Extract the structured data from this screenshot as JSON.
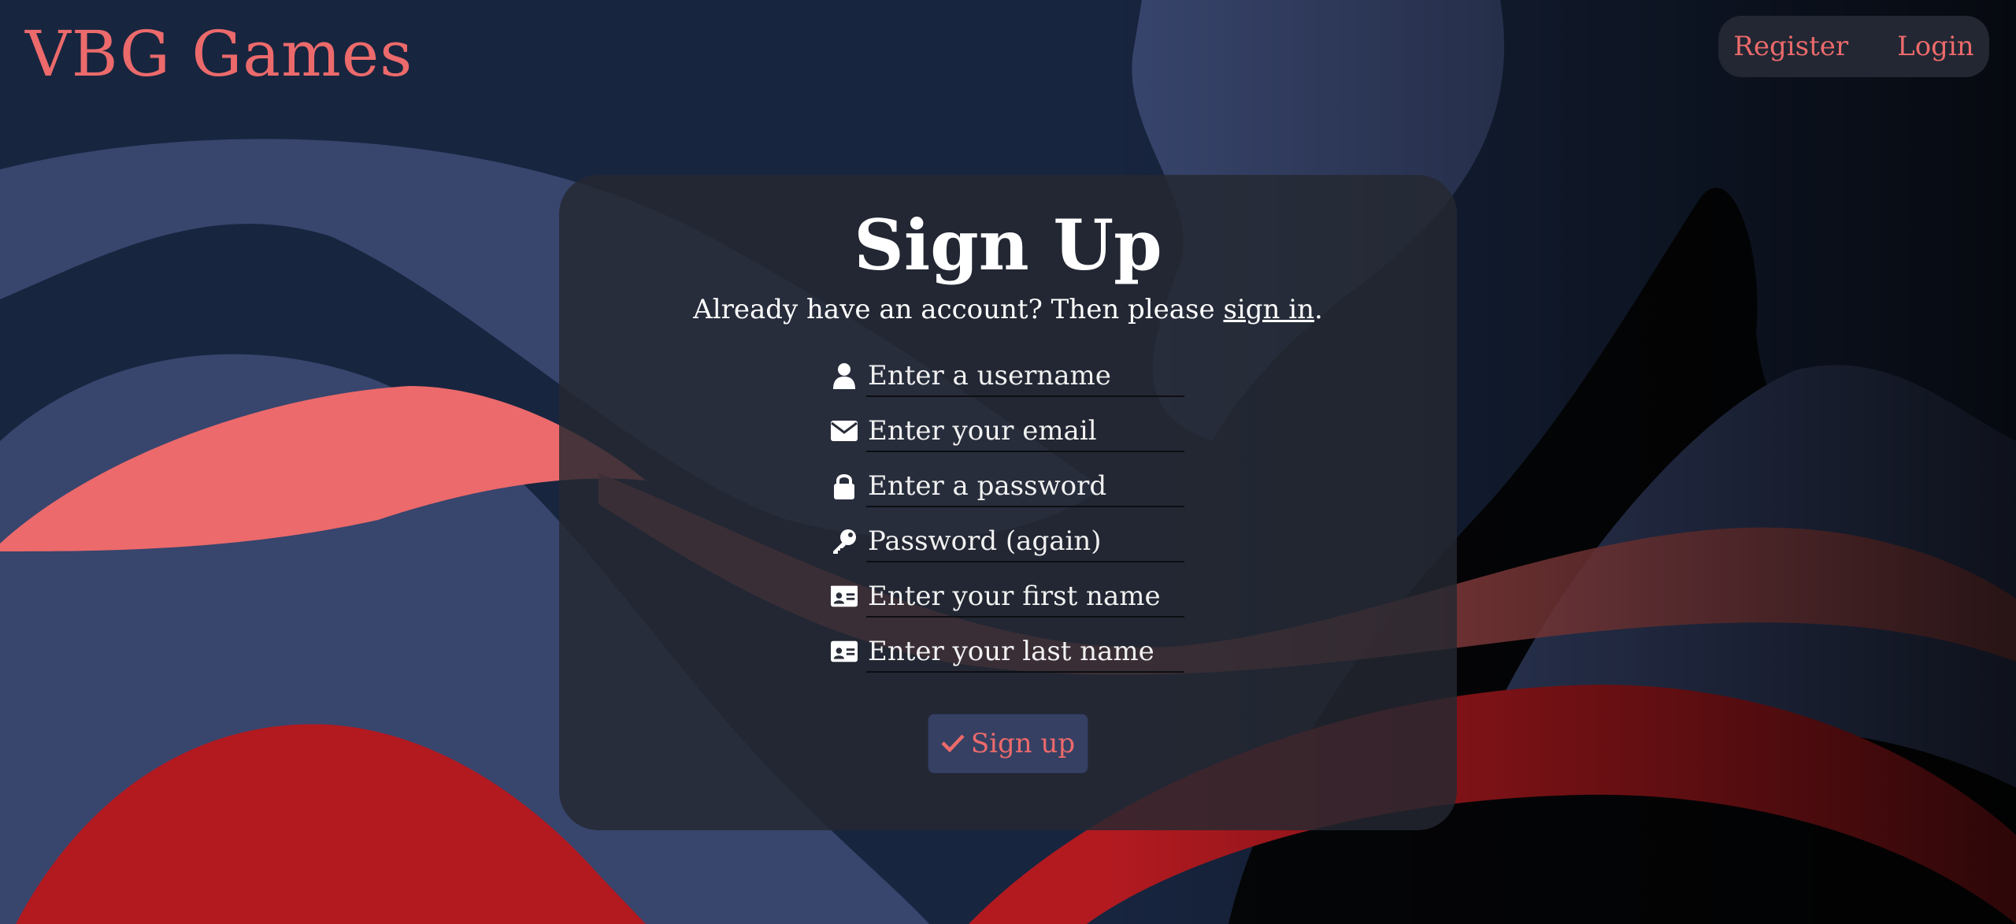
{
  "header": {
    "brand": "VBG Games",
    "nav": {
      "register": "Register",
      "login": "Login"
    }
  },
  "form": {
    "title": "Sign Up",
    "subtitle_prefix": "Already have an account? Then please ",
    "subtitle_link": "sign in",
    "subtitle_suffix": ".",
    "fields": {
      "username": {
        "placeholder": "Enter a username",
        "icon": "user-icon"
      },
      "email": {
        "placeholder": "Enter your email",
        "icon": "envelope-icon"
      },
      "password": {
        "placeholder": "Enter a password",
        "icon": "lock-icon"
      },
      "password_again": {
        "placeholder": "Password (again)",
        "icon": "key-icon"
      },
      "first_name": {
        "placeholder": "Enter your first name",
        "icon": "id-card-icon"
      },
      "last_name": {
        "placeholder": "Enter your last name",
        "icon": "id-card-icon"
      }
    },
    "submit": {
      "label": "Sign up",
      "icon": "check-icon"
    }
  },
  "colors": {
    "background": "#18253f",
    "accent": "#ec6a6b",
    "card": "#242831",
    "button": "#364063",
    "wave_light": "#38456d",
    "wave_red": "#b21a20"
  }
}
